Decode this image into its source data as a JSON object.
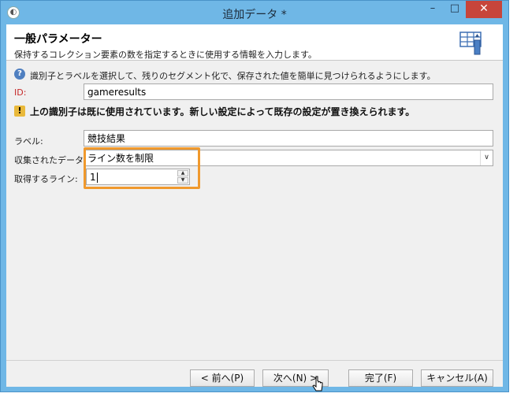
{
  "window": {
    "title": "追加データ *"
  },
  "titlebar": {
    "app_icon_glyph": "◐",
    "minimize_glyph": "–",
    "maximize_glyph": "□",
    "close_glyph": "✕"
  },
  "header": {
    "title": "一般パラメーター",
    "subtitle": "保持するコレクション要素の数を指定するときに使用する情報を入力します。",
    "icon": "table-settings-icon"
  },
  "info": {
    "icon": "help-icon",
    "icon_glyph": "?",
    "text": "識別子とラベルを選択して、残りのセグメント化で、保存された値を簡単に見つけられるようにします。"
  },
  "id_field": {
    "label": "ID:",
    "value": "gameresults"
  },
  "warning": {
    "icon": "warning-icon",
    "icon_glyph": "!",
    "text": "上の識別子は既に使用されています。新しい設定によって既存の設定が置き換えられます。"
  },
  "label_field": {
    "label": "ラベル:",
    "value": "競技結果"
  },
  "collected_data": {
    "label": "収集されたデータ:",
    "value": "ライン数を制限",
    "arrow_glyph": "∨"
  },
  "lines_field": {
    "label": "取得するライン:",
    "value": "1",
    "up_glyph": "▲",
    "down_glyph": "▼"
  },
  "buttons": {
    "prev": "< 前へ(P)",
    "next": "次へ(N) >",
    "finish": "完了(F)",
    "cancel": "キャンセル(A)"
  },
  "colors": {
    "titlebar": "#6fb7e6",
    "close": "#c7453b",
    "highlight": "#f0992d",
    "id_label": "#c62828"
  }
}
